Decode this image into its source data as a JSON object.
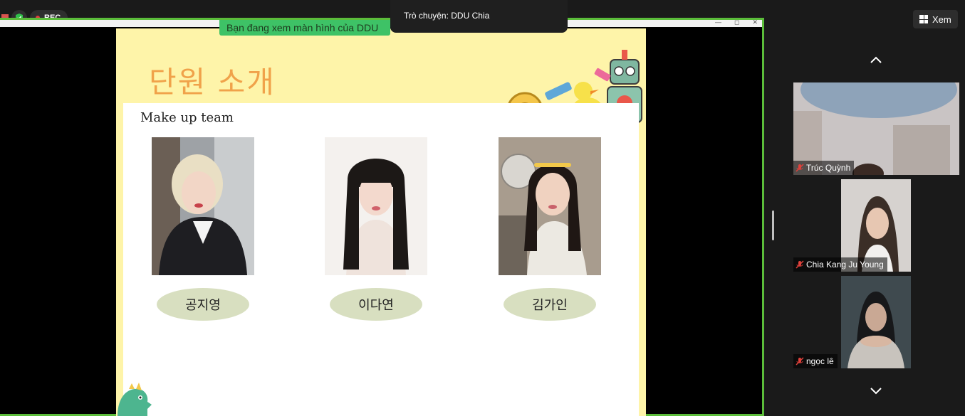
{
  "meeting": {
    "rec_label": "REC",
    "sharing_banner": "Bạn đang xem màn hình của DDU",
    "chat_toast": "Trò chuyện: DDU Chia",
    "view_button": "Xem"
  },
  "slide": {
    "title": "단원 소개",
    "heading": "Make up team",
    "members": [
      {
        "name": "공지영"
      },
      {
        "name": "이다연"
      },
      {
        "name": "김가인"
      }
    ]
  },
  "participants": [
    {
      "name": "Trúc Quỳnh",
      "muted": true
    },
    {
      "name": "Chia Kang Ju Young",
      "muted": true
    },
    {
      "name": "ngọc lê",
      "muted": true
    }
  ],
  "colors": {
    "share_border": "#5bbd3a",
    "banner_bg": "#3ec266",
    "slide_bg": "#fef4a9",
    "title_color": "#f0a24a",
    "name_oval": "#d8dfc0",
    "mute_red": "#e0413b"
  }
}
